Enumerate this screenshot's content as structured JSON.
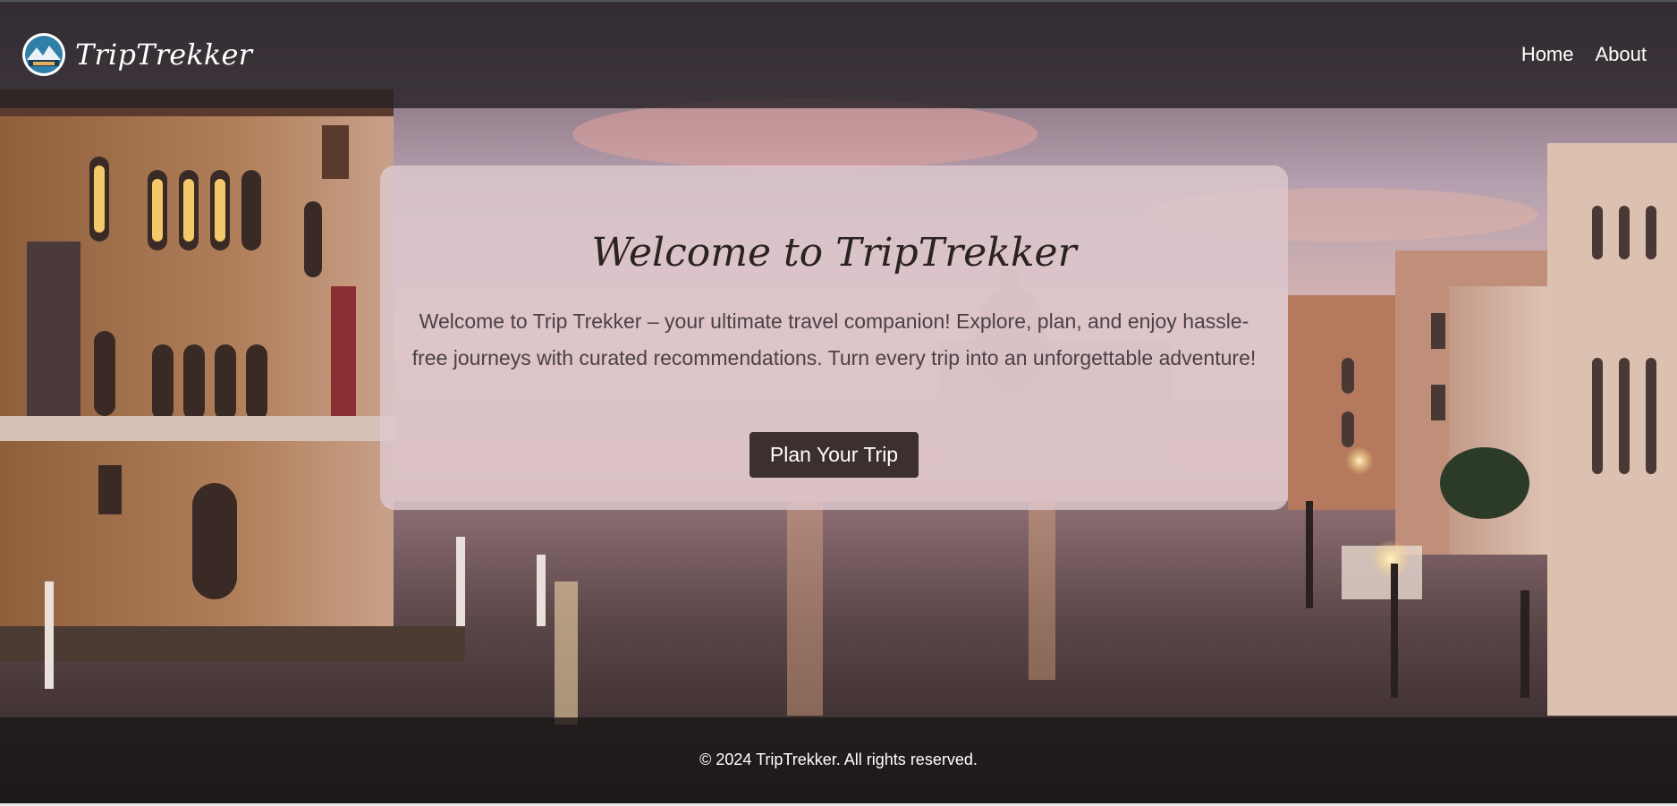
{
  "header": {
    "brand_name": "TripTrekker",
    "nav": [
      {
        "label": "Home"
      },
      {
        "label": "About"
      }
    ]
  },
  "hero": {
    "title": "Welcome to TripTrekker",
    "description": "Welcome to Trip Trekker – your ultimate travel companion! Explore, plan, and enjoy hassle-free journeys with curated recommendations. Turn every trip into an unforgettable adventure!",
    "cta_label": "Plan Your Trip"
  },
  "footer": {
    "copyright": "© 2024 TripTrekker. All rights reserved."
  },
  "colors": {
    "header_bg": "#262226",
    "card_bg": "#dec8ce",
    "button_bg": "#3b2f30",
    "footer_bg": "#1c1818"
  },
  "icons": {
    "logo": "triptrekker-logo-icon"
  }
}
